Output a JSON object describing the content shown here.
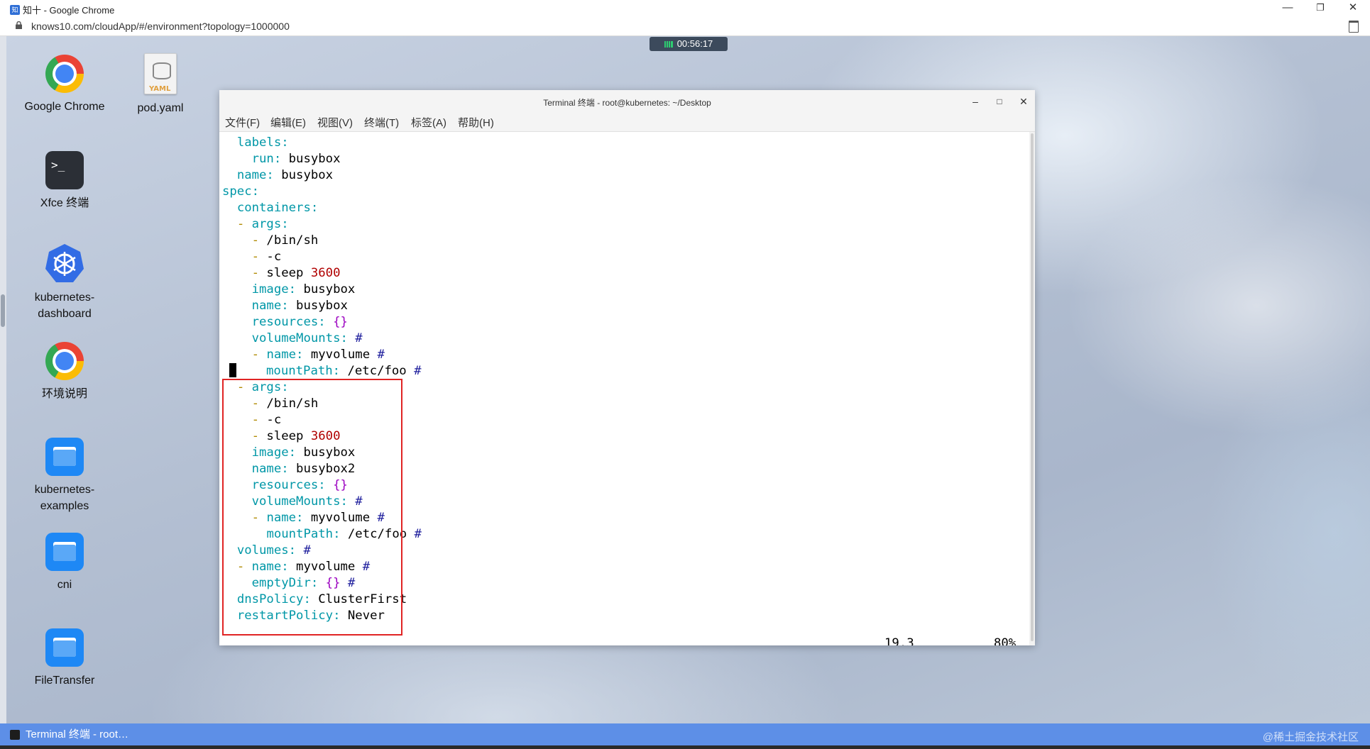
{
  "browser": {
    "title": "知十 - Google Chrome",
    "favicon_text": "知十",
    "url": "knows10.com/cloudApp/#/environment?topology=1000000",
    "controls": {
      "minimize": "—",
      "restore": "❐",
      "close": "✕"
    }
  },
  "session": {
    "timer": "00:56:17"
  },
  "desktop": {
    "icons": [
      {
        "label": "Google Chrome",
        "icon": "chrome-icon"
      },
      {
        "label": "pod.yaml",
        "icon": "yaml-file-icon",
        "badge": "YAML"
      },
      {
        "label": "Xfce 终端",
        "icon": "terminal-icon",
        "glyph": ">_"
      },
      {
        "label": "kubernetes-\ndashboard",
        "icon": "kubernetes-icon"
      },
      {
        "label": "环境说明",
        "icon": "chrome-icon"
      },
      {
        "label": "kubernetes-\nexamples",
        "icon": "folder-icon"
      },
      {
        "label": "cni",
        "icon": "folder-icon"
      },
      {
        "label": "FileTransfer",
        "icon": "folder-icon"
      }
    ]
  },
  "terminal": {
    "title": "Terminal 终端 - root@kubernetes: ~/Desktop",
    "controls": {
      "minimize": "–",
      "maximize": "□",
      "close": "✕"
    },
    "menu": [
      "文件(F)",
      "编辑(E)",
      "视图(V)",
      "终端(T)",
      "标签(A)",
      "帮助(H)"
    ],
    "lines": [
      "  labels:",
      "    run: busybox",
      "  name: busybox",
      "spec:",
      "  containers:",
      "  - args:",
      "    - /bin/sh",
      "    - -c",
      "    - sleep 3600",
      "    image: busybox",
      "    name: busybox",
      "    resources: {}",
      "    volumeMounts: #",
      "    - name: myvolume #",
      "      mountPath: /etc/foo #",
      "  - args:",
      "    - /bin/sh",
      "    - -c",
      "    - sleep 3600",
      "    image: busybox",
      "    name: busybox2",
      "    resources: {}",
      "    volumeMounts: #",
      "    - name: myvolume #",
      "      mountPath: /etc/foo #",
      "  volumes: #",
      "  - name: myvolume #",
      "    emptyDir: {} #",
      "  dnsPolicy: ClusterFirst",
      "  restartPolicy: Never"
    ],
    "cursor_line": 15,
    "status": {
      "position": "19,3",
      "percent": "80%"
    },
    "colors": {
      "key": "#0097a7",
      "dash": "#b08a00",
      "number": "#b00000",
      "brace": "#9b00c0",
      "hash": "#1d1d9c",
      "highlight_box": "#e02424"
    }
  },
  "taskbar": {
    "task_label": "Terminal 终端 - root…",
    "watermark": "@稀土掘金技术社区"
  }
}
